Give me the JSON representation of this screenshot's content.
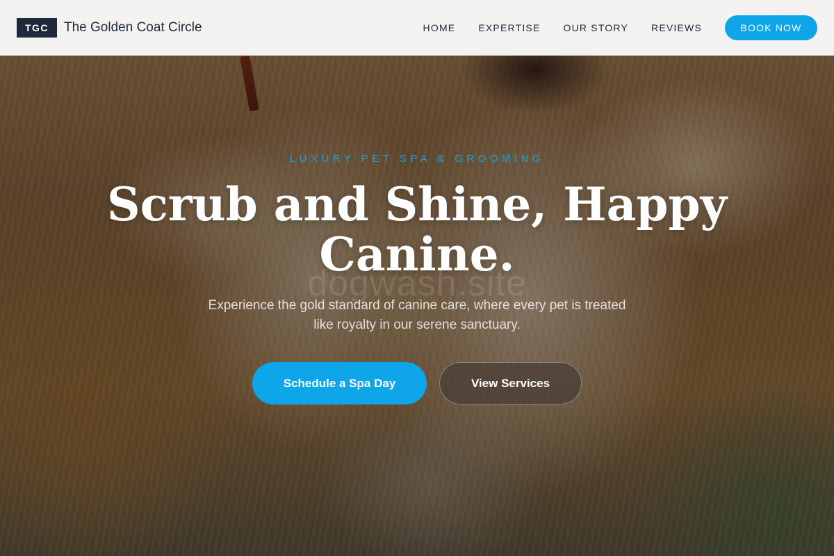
{
  "brand": {
    "badge": "TGC",
    "name": "The Golden Coat Circle"
  },
  "nav": {
    "links": [
      "HOME",
      "EXPERTISE",
      "OUR STORY",
      "REVIEWS"
    ],
    "cta": "BOOK NOW"
  },
  "hero": {
    "eyebrow": "LUXURY PET SPA & GROOMING",
    "headline_line1": "Scrub and Shine, Happy",
    "headline_line2": "Canine.",
    "watermark": "dogwash.site",
    "subtext_line1": "Experience the gold standard of canine care, where every pet is treated",
    "subtext_line2": "like royalty in our serene sanctuary.",
    "primary_cta": "Schedule a Spa Day",
    "secondary_cta": "View Services",
    "background_image": "dog-grooming-photo"
  },
  "colors": {
    "accent": "#0ea5e9",
    "eyebrow": "#1aa3dc",
    "brand_dark": "#1e2a3c",
    "header_bg": "#f8f8f8"
  }
}
